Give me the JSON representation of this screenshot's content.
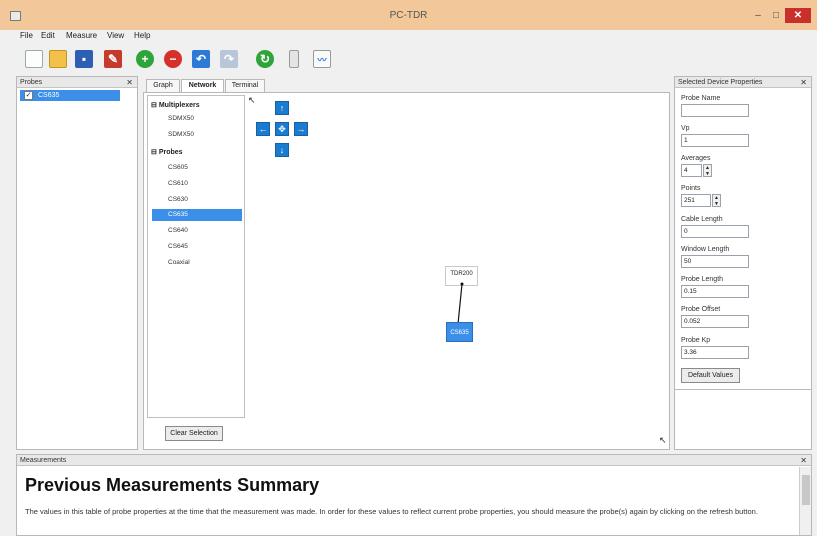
{
  "app": {
    "title": "PC-TDR"
  },
  "window_controls": {
    "minimize": "–",
    "maximize": "□",
    "close": "✕"
  },
  "menu": [
    "File",
    "Edit",
    "Measure",
    "View",
    "Help"
  ],
  "toolbar": {
    "icons": [
      "new-file-icon",
      "open-folder-icon",
      "save-icon",
      "clear-icon",
      "add-icon",
      "remove-icon",
      "undo-icon",
      "redo-icon",
      "refresh-icon",
      "device-icon",
      "chart-icon"
    ]
  },
  "probes_panel": {
    "title": "Probes",
    "close": "✕",
    "items": [
      {
        "label": "CS635",
        "checked": true
      }
    ]
  },
  "center": {
    "tabs": [
      "Graph",
      "Network",
      "Terminal"
    ],
    "active_tab": "Network",
    "groups": [
      {
        "label": "Multiplexers",
        "expander": "⊟",
        "items": [
          "SDMX50",
          "SDMX50"
        ]
      },
      {
        "label": "Probes",
        "expander": "⊟",
        "items": [
          "CS605",
          "CS610",
          "CS630",
          "CS635",
          "CS640",
          "CS645",
          "Coaxial"
        ],
        "selected": "CS635"
      }
    ],
    "clear_selection": "Clear Selection",
    "nodes": {
      "device": "TDR200",
      "probe": "CS635"
    },
    "nav_arrows": {
      "up": "↑",
      "down": "↓",
      "left": "←",
      "right": "→",
      "center": "✥"
    }
  },
  "properties": {
    "title": "Selected Device Properties",
    "close": "✕",
    "fields": [
      {
        "label": "Probe Name",
        "value": ""
      },
      {
        "label": "Vp",
        "value": "1"
      },
      {
        "label": "Averages",
        "value": "4",
        "spin": true
      },
      {
        "label": "Points",
        "value": "251",
        "spin": true
      },
      {
        "label": "Cable Length",
        "value": "0"
      },
      {
        "label": "Window Length",
        "value": "50"
      },
      {
        "label": "Probe Length",
        "value": "0.15"
      },
      {
        "label": "Probe Offset",
        "value": "0.052"
      },
      {
        "label": "Probe Kp",
        "value": "3.36"
      }
    ],
    "default_button": "Default Values"
  },
  "measurements": {
    "title": "Measurements",
    "close": "✕",
    "heading": "Previous Measurements Summary",
    "body": "The values in this table of probe properties at the time that the measurement was made. In order for these values to reflect current probe properties, you should measure the probe(s) again by clicking on the refresh button."
  },
  "colors": {
    "titlebar": "#f2c89a",
    "close": "#c9302c",
    "accent": "#3b8fe8",
    "node_blue": "#1b7ccf"
  }
}
